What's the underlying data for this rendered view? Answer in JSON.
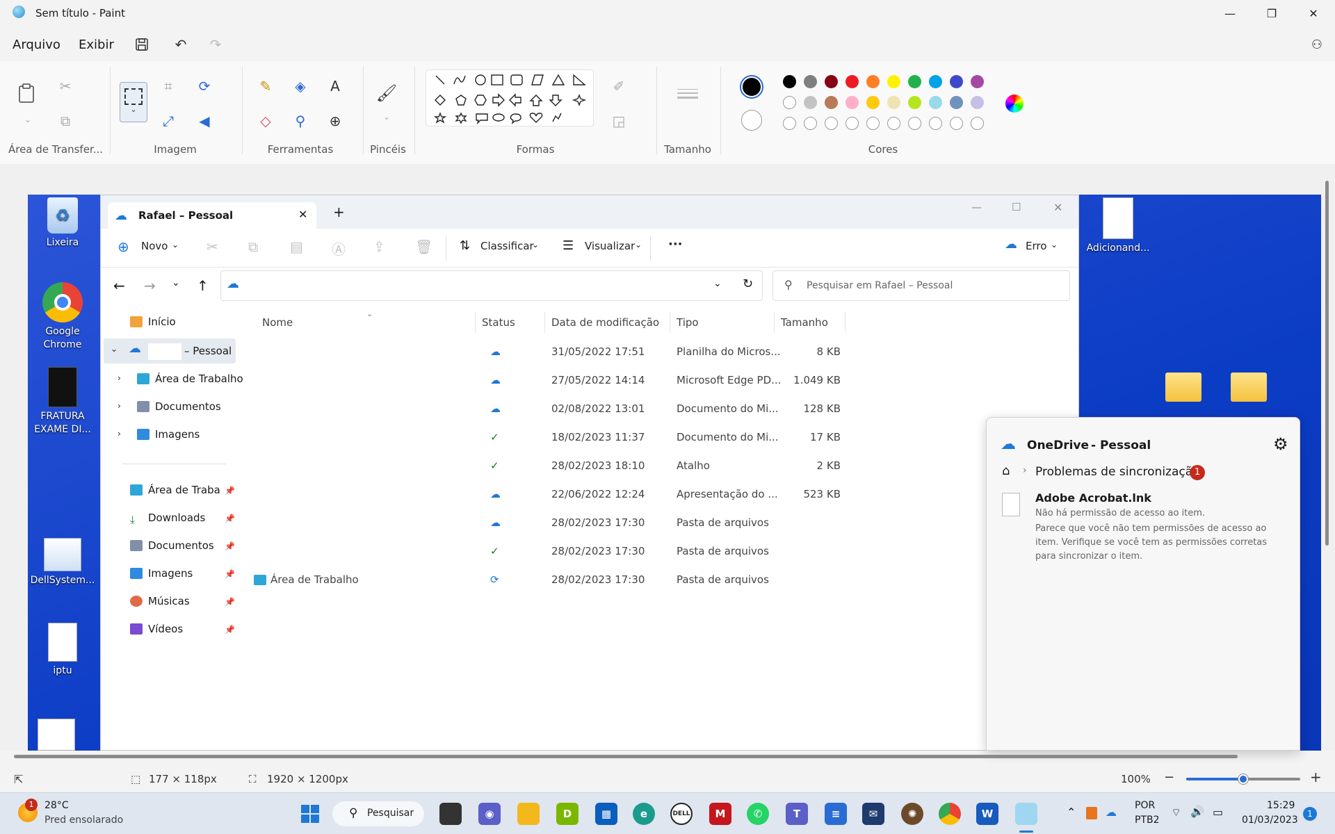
{
  "window": {
    "title": "Sem título - Paint",
    "minimize": "—",
    "maximize": "❐",
    "close": "✕"
  },
  "menu": {
    "file": "Arquivo",
    "view": "Exibir"
  },
  "ribbon": {
    "groups": {
      "clipboard": "Área de Transfer...",
      "image": "Imagem",
      "tools": "Ferramentas",
      "brushes": "Pincéis",
      "shapes": "Formas",
      "size": "Tamanho",
      "colors": "Cores"
    },
    "colors": {
      "row1": [
        "#000000",
        "#7f7f7f",
        "#880015",
        "#ed1c24",
        "#ff7f27",
        "#fff200",
        "#22b14c",
        "#00a2e8",
        "#3f48cc",
        "#a349a4"
      ],
      "row2": [
        "#ffffff",
        "#c3c3c3",
        "#b97a57",
        "#ffaec9",
        "#ffc90e",
        "#efe4b0",
        "#b5e61d",
        "#99d9ea",
        "#7092be",
        "#c8bfe7"
      ],
      "primary": "#000000",
      "secondary": "#ffffff"
    }
  },
  "desktop": {
    "icons": [
      {
        "label": "Lixeira"
      },
      {
        "label": "Google Chrome"
      },
      {
        "label": "FRATURA EXAME DI..."
      },
      {
        "label": "DellSystem..."
      },
      {
        "label": "iptu"
      },
      {
        "label": "Adicionand..."
      }
    ]
  },
  "explorer": {
    "tab_title": "Rafael – Pessoal",
    "tab_add": "+",
    "cmd": {
      "new": "Novo",
      "sort": "Classificar",
      "view": "Visualizar",
      "more": "···",
      "error": "Erro"
    },
    "search_placeholder": "Pesquisar em Rafael – Pessoal",
    "nav": {
      "home": "Início",
      "onedrive": "– Pessoal",
      "desktop": "Área de Trabalho",
      "documents": "Documentos",
      "images": "Imagens",
      "quick": [
        {
          "label": "Área de Trabalho"
        },
        {
          "label": "Downloads"
        },
        {
          "label": "Documentos"
        },
        {
          "label": "Imagens"
        },
        {
          "label": "Músicas"
        },
        {
          "label": "Vídeos"
        }
      ]
    },
    "columns": {
      "name": "Nome",
      "status": "Status",
      "date": "Data de modificação",
      "type": "Tipo",
      "size": "Tamanho"
    },
    "rows": [
      {
        "name": "",
        "status": "cloud",
        "date": "31/05/2022 17:51",
        "type": "Planilha do Micros...",
        "size": "8 KB"
      },
      {
        "name": "",
        "status": "cloud",
        "date": "27/05/2022 14:14",
        "type": "Microsoft Edge PD...",
        "size": "1.049 KB"
      },
      {
        "name": "",
        "status": "cloud",
        "date": "02/08/2022 13:01",
        "type": "Documento do Mi...",
        "size": "128 KB"
      },
      {
        "name": "",
        "status": "ok",
        "date": "18/02/2023 11:37",
        "type": "Documento do Mi...",
        "size": "17 KB"
      },
      {
        "name": "",
        "status": "ok",
        "date": "28/02/2023 18:10",
        "type": "Atalho",
        "size": "2 KB"
      },
      {
        "name": "",
        "status": "cloud",
        "date": "22/06/2022 12:24",
        "type": "Apresentação do ...",
        "size": "523 KB"
      },
      {
        "name": "",
        "status": "cloud",
        "date": "28/02/2023 17:30",
        "type": "Pasta de arquivos",
        "size": ""
      },
      {
        "name": "",
        "status": "ok",
        "date": "28/02/2023 17:30",
        "type": "Pasta de arquivos",
        "size": ""
      },
      {
        "name": "Área de Trabalho",
        "status": "sync",
        "date": "28/02/2023 17:30",
        "type": "Pasta de arquivos",
        "size": ""
      }
    ]
  },
  "onedrive": {
    "title": "OneDrive",
    "account": "- Pessoal",
    "section": "Problemas de sincronização",
    "badge": "1",
    "item_name": "Adobe Acrobat.lnk",
    "item_error": "Não há permissão de acesso ao item.",
    "item_detail": "Parece que você não tem permissões de acesso ao item. Verifique se você tem as permissões corretas para sincronizar o item."
  },
  "statusbar": {
    "selection": "177 × 118px",
    "canvas": "1920 × 1200px",
    "zoom": "100%",
    "zoom_level": 0.5
  },
  "taskbar": {
    "weather_temp": "28°C",
    "weather_desc": "Pred ensolarado",
    "weather_badge": "1",
    "search": "Pesquisar",
    "lang1": "POR",
    "lang2": "PTB2",
    "time": "15:29",
    "date": "01/03/2023",
    "notif": "1"
  }
}
